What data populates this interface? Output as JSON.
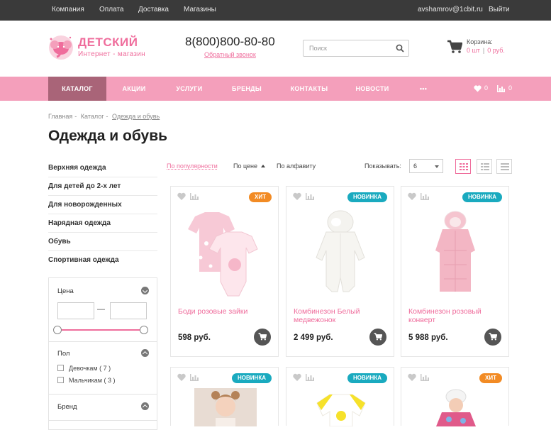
{
  "topbar": {
    "links": [
      "Компания",
      "Оплата",
      "Доставка",
      "Магазины"
    ],
    "user_email": "avshamrov@1cbit.ru",
    "logout": "Выйти"
  },
  "header": {
    "logo_title": "ДЕТСКИЙ",
    "logo_subtitle": "Интернет - магазин",
    "phone": "8(800)800-80-80",
    "callback": "Обратный звонок",
    "search_placeholder": "Поиск",
    "cart_label": "Корзина:",
    "cart_count": "0 шт",
    "cart_sum": "0 руб."
  },
  "nav": {
    "items": [
      "КАТАЛОГ",
      "АКЦИИ",
      "УСЛУГИ",
      "БРЕНДЫ",
      "КОНТАКТЫ",
      "НОВОСТИ",
      "•••"
    ],
    "favorites_count": "0",
    "compare_count": "0"
  },
  "breadcrumbs": [
    "Главная",
    "Каталог",
    "Одежда и обувь"
  ],
  "page_title": "Одежда и обувь",
  "sidebar": {
    "categories": [
      "Верхняя одежда",
      "Для детей до 2-х лет",
      "Для новорожденных",
      "Нарядная одежда",
      "Обувь",
      "Спортивная одежда"
    ],
    "filter_price": "Цена",
    "filter_gender": "Пол",
    "gender_options": [
      "Девочкам  ( 7 )",
      "Мальчикам  ( 3 )"
    ],
    "filter_brand": "Бренд"
  },
  "sort": {
    "by_popularity": "По популярности",
    "by_price": "По цене",
    "by_alpha": "По алфавиту",
    "show_label": "Показывать:",
    "show_value": "6"
  },
  "products": [
    {
      "badge": "ХИТ",
      "badge_type": "hit",
      "name": "Боди розовые зайки",
      "price": "598 руб."
    },
    {
      "badge": "НОВИНКА",
      "badge_type": "new",
      "name": "Комбинезон Белый медвежонок",
      "price": "2 499 руб."
    },
    {
      "badge": "НОВИНКА",
      "badge_type": "new",
      "name": "Комбинезон розовый конверт",
      "price": "5 988 руб."
    },
    {
      "badge": "НОВИНКА",
      "badge_type": "new",
      "name": "",
      "price": ""
    },
    {
      "badge": "НОВИНКА",
      "badge_type": "new",
      "name": "",
      "price": ""
    },
    {
      "badge": "ХИТ",
      "badge_type": "hit",
      "name": "",
      "price": ""
    }
  ],
  "colors": {
    "accent": "#ef6d9c",
    "nav": "#f49fbb",
    "nav_active": "#a96478",
    "hit": "#f28b24",
    "new": "#1aaabf"
  }
}
